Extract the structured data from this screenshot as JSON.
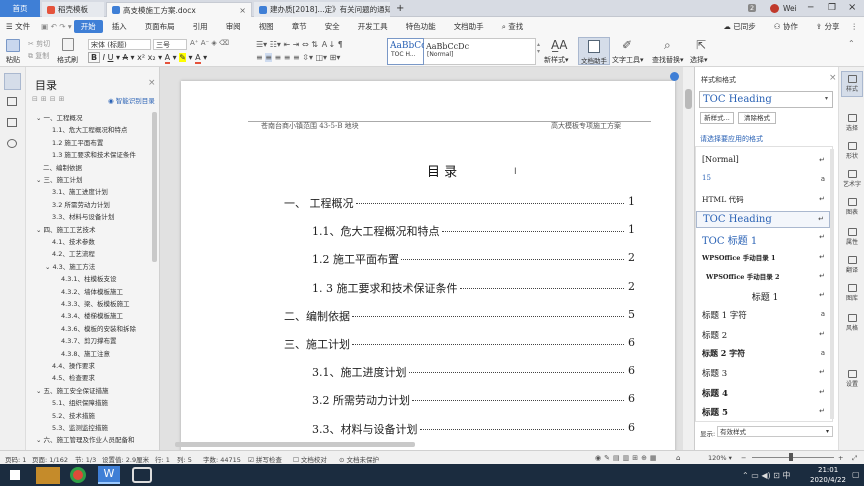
{
  "tabs": {
    "home": "首页",
    "tab1": "稻壳模板",
    "tab2": "高支模施工方案.docx",
    "tab3": "建办质[2018]...定》有关问题的通知",
    "add": "+",
    "badge": "2",
    "user": "Wei"
  },
  "menu": {
    "file": "文件",
    "items": [
      "开始",
      "插入",
      "页面布局",
      "引用",
      "审阅",
      "视图",
      "章节",
      "安全",
      "开发工具",
      "特色功能",
      "文档助手"
    ],
    "search": "查找",
    "sync": "已同步",
    "collab": "协作",
    "share": "分享"
  },
  "toolbar": {
    "paste": "粘贴",
    "cut": "剪切",
    "copy": "复制",
    "format_painter": "格式刷",
    "font": "宋体 (标题)",
    "size": "三号",
    "style1_preview": "AaBbCc",
    "style1": "TOC H...",
    "style2_preview": "AaBbCcDc",
    "style2": "[Normal]",
    "new_style": "新样式",
    "text_helper": "文档助手",
    "text_tools": "文字工具",
    "find_replace": "查找替换",
    "select": "选择"
  },
  "nav": {
    "title": "目录",
    "smart": "智能识别目录",
    "items": [
      {
        "text": "一、工程概况",
        "level": 0,
        "arrow": "⌄"
      },
      {
        "text": "1.1、危大工程概况和特点",
        "level": 1
      },
      {
        "text": "1.2 施工平面布置",
        "level": 1
      },
      {
        "text": "1.3 施工要求和技术保证条件",
        "level": 1
      },
      {
        "text": "二、编制依据",
        "level": 0
      },
      {
        "text": "三、施工计划",
        "level": 0,
        "arrow": "⌄"
      },
      {
        "text": "3.1、施工进度计划",
        "level": 1
      },
      {
        "text": "3.2 所需劳动力计划",
        "level": 1
      },
      {
        "text": "3.3、材料与设备计划",
        "level": 1
      },
      {
        "text": "四、施工工艺技术",
        "level": 0,
        "arrow": "⌄"
      },
      {
        "text": "4.1、技术参数",
        "level": 1
      },
      {
        "text": "4.2、工艺流程",
        "level": 1
      },
      {
        "text": "4.3、施工方法",
        "level": 1,
        "arrow": "⌄"
      },
      {
        "text": "4.3.1、柱模板支设",
        "level": 2
      },
      {
        "text": "4.3.2、墙体模板施工",
        "level": 2
      },
      {
        "text": "4.3.3、梁、板模板施工",
        "level": 2
      },
      {
        "text": "4.3.4、楼梯模板施工",
        "level": 2
      },
      {
        "text": "4.3.6、模板的安装和拆除",
        "level": 2
      },
      {
        "text": "4.3.7、剪刀撑布置",
        "level": 2
      },
      {
        "text": "4.3.8、施工注意",
        "level": 2
      },
      {
        "text": "4.4、操作要求",
        "level": 1
      },
      {
        "text": "4.5、检查要求",
        "level": 1
      },
      {
        "text": "五、施工安全保证措施",
        "level": 0,
        "arrow": "⌄"
      },
      {
        "text": "5.1、组织保障措施",
        "level": 1
      },
      {
        "text": "5.2、技术措施",
        "level": 1
      },
      {
        "text": "5.3、监测监控措施",
        "level": 1
      },
      {
        "text": "六、施工管理及作业人员配备和",
        "level": 0,
        "arrow": "⌄"
      }
    ]
  },
  "doc": {
    "header_left": "苍南台商小镇范围 43-5-B 地块",
    "header_right": "高大模板专项施工方案",
    "title": "目  录",
    "entries": [
      {
        "text": "一、  工程概况",
        "page": "1",
        "indent": 0
      },
      {
        "text": "1.1、危大工程概况和特点",
        "page": "1",
        "indent": 1
      },
      {
        "text": "1.2 施工平面布置",
        "page": "2",
        "indent": 1
      },
      {
        "text": "1. 3 施工要求和技术保证条件",
        "page": "2",
        "indent": 1
      },
      {
        "text": "二、编制依据",
        "page": "5",
        "indent": 0
      },
      {
        "text": "三、施工计划",
        "page": "6",
        "indent": 0
      },
      {
        "text": "3.1、施工进度计划",
        "page": "6",
        "indent": 1
      },
      {
        "text": "3.2 所需劳动力计划",
        "page": "6",
        "indent": 1
      },
      {
        "text": "3.3、材料与设备计划",
        "page": "6",
        "indent": 1
      }
    ]
  },
  "styles": {
    "title": "样式和格式",
    "current": "TOC Heading",
    "new_style": "新样式...",
    "clear": "清除格式",
    "apply_label": "请选择要应用的格式",
    "items": [
      {
        "text": "[Normal]",
        "sym": "↵"
      },
      {
        "text": "15",
        "sym": "a"
      },
      {
        "text": "HTML 代码",
        "sym": "↵"
      },
      {
        "text": "TOC Heading",
        "sym": "↵"
      },
      {
        "text": "TOC  标题 1",
        "sym": "↵"
      },
      {
        "text": "WPSOffice 手动目录 1",
        "sym": "↵"
      },
      {
        "text": "WPSOffice 手动目录 2",
        "sym": "↵"
      },
      {
        "text": "标题 1",
        "sym": "↵"
      },
      {
        "text": "标题 1 字符",
        "sym": "a"
      },
      {
        "text": "标题 2",
        "sym": "↵"
      },
      {
        "text": "标题 2 字符",
        "sym": "a"
      },
      {
        "text": "标题 3",
        "sym": "↵"
      },
      {
        "text": "标题 4",
        "sym": "↵"
      },
      {
        "text": "标题 5",
        "sym": "↵"
      }
    ],
    "show_label": "显示:",
    "show_value": "有效样式"
  },
  "rightbar": [
    "样式",
    "选择",
    "形状",
    "艺术字",
    "图表",
    "属性",
    "翻译",
    "图库",
    "风格",
    "设置"
  ],
  "status": {
    "page": "页码: 1",
    "pages": "页面: 1/162",
    "section": "节: 1/3",
    "setting": "设置值: 2.9厘米",
    "row": "行: 1",
    "col": "列: 5",
    "words": "字数: 44715",
    "spell": "拼写检查",
    "compare": "文档校对",
    "unprotected": "文档未保护",
    "zoom": "120%"
  },
  "taskbar": {
    "time": "21:01",
    "date": "2020/4/22"
  },
  "colors": {
    "accent": "#3f7fd6",
    "taskbar": "#1b2c3f"
  }
}
